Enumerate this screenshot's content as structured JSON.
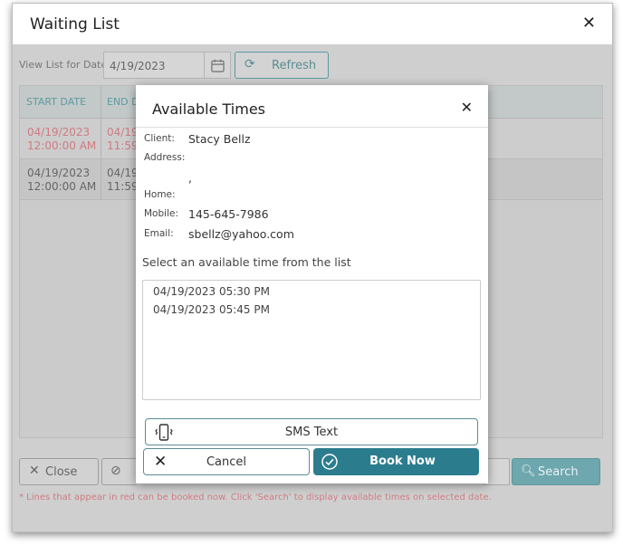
{
  "window": {
    "title": "Waiting List"
  },
  "toolbar": {
    "view_label": "View List for Date",
    "date_value": "4/19/2023",
    "refresh_label": "Refresh"
  },
  "grid": {
    "columns": [
      "START DATE",
      "END D"
    ],
    "rows": [
      {
        "start_date": "04/19/2023",
        "start_time": "12:00:00 AM",
        "end_date": "04/19",
        "end_time": "11:59:",
        "bookable": true
      },
      {
        "start_date": "04/19/2023",
        "start_time": "12:00:00 AM",
        "end_date": "04/19",
        "end_time": "11:59:",
        "bookable": false
      }
    ]
  },
  "bottom": {
    "close_label": "Close",
    "search_label": "Search",
    "footnote": "* Lines that appear in red can be booked now. Click 'Search' to display available times on selected date."
  },
  "modal": {
    "title": "Available Times",
    "client_label": "Client:",
    "client_value": "Stacy Bellz",
    "address_label": "Address:",
    "address_value": ",",
    "home_label": "Home:",
    "mobile_label": "Mobile:",
    "mobile_value": "145-645-7986",
    "email_label": "Email:",
    "email_value": "sbellz@yahoo.com",
    "prompt": "Select an available time from the list",
    "times": [
      "04/19/2023 05:30 PM",
      "04/19/2023 05:45 PM"
    ],
    "sms_label": "SMS Text",
    "cancel_label": "Cancel",
    "book_label": "Book Now"
  },
  "colors": {
    "accent": "#2b7d8e",
    "bookable_red": "#cf7b82",
    "outline_teal": "#5a8d93"
  }
}
